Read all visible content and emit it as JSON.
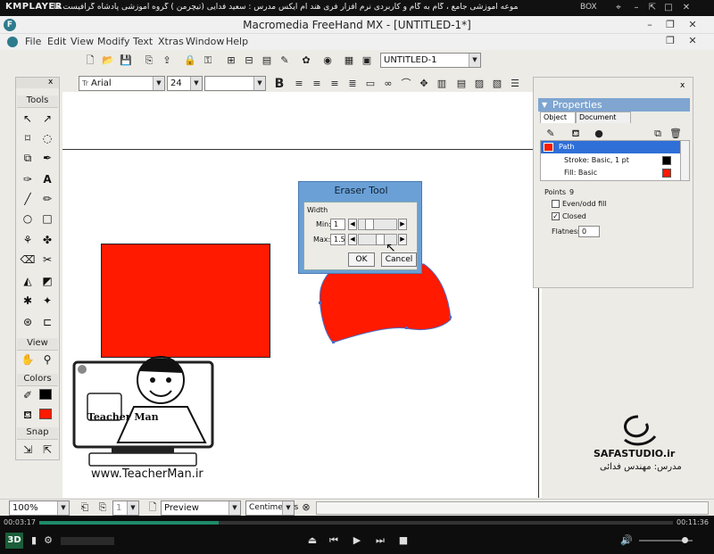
{
  "player": {
    "logo": "KMPLAYER",
    "title": "مجموعه آموزشی جامع ، گام به گام و کاربردی نرم افزار فری هند ام ایکس  مدرس : سعید فدایی (تیچرمن ) گروه آموزشی پادشاه گرافیست ها",
    "box_label": "BOX",
    "time_elapsed": "00:03:17",
    "time_total": "00:11:36",
    "progress": 0.283,
    "volume": 0.85,
    "badge": "3D"
  },
  "app": {
    "title": "Macromedia FreeHand MX - [UNTITLED-1*]",
    "menu": [
      "File",
      "Edit",
      "View",
      "Modify",
      "Text",
      "Xtras",
      "Window",
      "Help"
    ],
    "document_combo": "UNTITLED-1",
    "font_name": "Arial",
    "font_size": "24",
    "bold": "B"
  },
  "tools_panel": {
    "tools_label": "Tools",
    "view_label": "View",
    "colors_label": "Colors",
    "snap_label": "Snap",
    "close": "x"
  },
  "properties": {
    "title": "Properties",
    "tab_object": "Object",
    "tab_document": "Document",
    "row_path": "Path",
    "row_stroke": "Stroke: Basic, 1 pt",
    "row_fill": "Fill: Basic",
    "points_label": "Points",
    "points_value": "9",
    "evenodd_label": "Even/odd fill",
    "closed_label": "Closed",
    "flatness_label": "Flatness:",
    "flatness_value": "0",
    "close": "x"
  },
  "eraser_dialog": {
    "title": "Eraser Tool",
    "group_label": "Width",
    "min_label": "Min:",
    "min_value": "1",
    "max_label": "Max:",
    "max_value": "1.5",
    "ok_label": "OK",
    "cancel_label": "Cancel"
  },
  "status": {
    "zoom": "100%",
    "page": "1",
    "view_mode": "Preview",
    "units": "Centimeters"
  },
  "watermark": {
    "site": "www.TeacherMan.ir",
    "brand": "Teacher Man",
    "studio": "SAFASTUDIO.ir",
    "teacher": "مدرس: مهندس فدائی"
  },
  "colors": {
    "red": "#ff1a00",
    "canvas": "#ffffff",
    "ui": "#ecebe6"
  }
}
